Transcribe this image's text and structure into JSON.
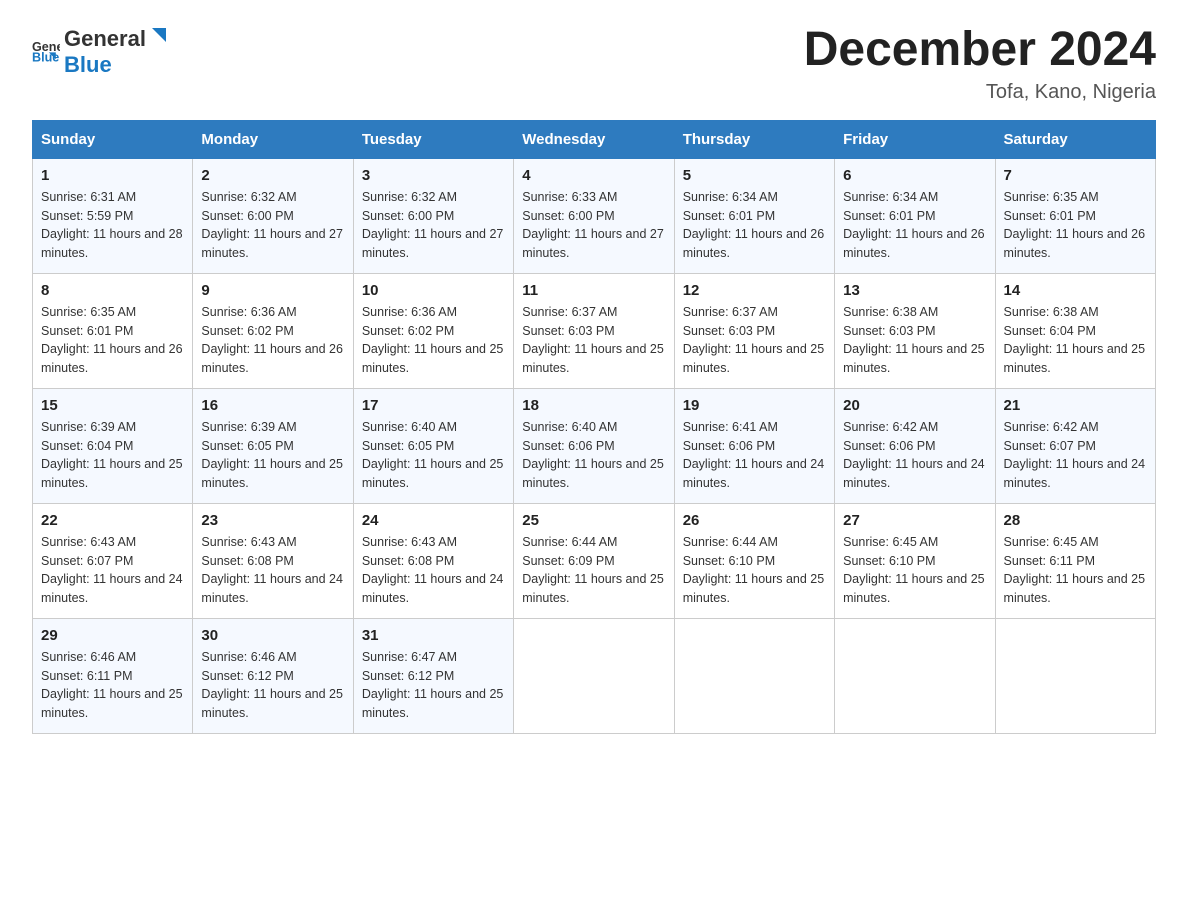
{
  "header": {
    "logo_general": "General",
    "logo_blue": "Blue",
    "title": "December 2024",
    "location": "Tofa, Kano, Nigeria"
  },
  "days_of_week": [
    "Sunday",
    "Monday",
    "Tuesday",
    "Wednesday",
    "Thursday",
    "Friday",
    "Saturday"
  ],
  "weeks": [
    [
      {
        "day": "1",
        "sunrise": "6:31 AM",
        "sunset": "5:59 PM",
        "daylight": "11 hours and 28 minutes."
      },
      {
        "day": "2",
        "sunrise": "6:32 AM",
        "sunset": "6:00 PM",
        "daylight": "11 hours and 27 minutes."
      },
      {
        "day": "3",
        "sunrise": "6:32 AM",
        "sunset": "6:00 PM",
        "daylight": "11 hours and 27 minutes."
      },
      {
        "day": "4",
        "sunrise": "6:33 AM",
        "sunset": "6:00 PM",
        "daylight": "11 hours and 27 minutes."
      },
      {
        "day": "5",
        "sunrise": "6:34 AM",
        "sunset": "6:01 PM",
        "daylight": "11 hours and 26 minutes."
      },
      {
        "day": "6",
        "sunrise": "6:34 AM",
        "sunset": "6:01 PM",
        "daylight": "11 hours and 26 minutes."
      },
      {
        "day": "7",
        "sunrise": "6:35 AM",
        "sunset": "6:01 PM",
        "daylight": "11 hours and 26 minutes."
      }
    ],
    [
      {
        "day": "8",
        "sunrise": "6:35 AM",
        "sunset": "6:01 PM",
        "daylight": "11 hours and 26 minutes."
      },
      {
        "day": "9",
        "sunrise": "6:36 AM",
        "sunset": "6:02 PM",
        "daylight": "11 hours and 26 minutes."
      },
      {
        "day": "10",
        "sunrise": "6:36 AM",
        "sunset": "6:02 PM",
        "daylight": "11 hours and 25 minutes."
      },
      {
        "day": "11",
        "sunrise": "6:37 AM",
        "sunset": "6:03 PM",
        "daylight": "11 hours and 25 minutes."
      },
      {
        "day": "12",
        "sunrise": "6:37 AM",
        "sunset": "6:03 PM",
        "daylight": "11 hours and 25 minutes."
      },
      {
        "day": "13",
        "sunrise": "6:38 AM",
        "sunset": "6:03 PM",
        "daylight": "11 hours and 25 minutes."
      },
      {
        "day": "14",
        "sunrise": "6:38 AM",
        "sunset": "6:04 PM",
        "daylight": "11 hours and 25 minutes."
      }
    ],
    [
      {
        "day": "15",
        "sunrise": "6:39 AM",
        "sunset": "6:04 PM",
        "daylight": "11 hours and 25 minutes."
      },
      {
        "day": "16",
        "sunrise": "6:39 AM",
        "sunset": "6:05 PM",
        "daylight": "11 hours and 25 minutes."
      },
      {
        "day": "17",
        "sunrise": "6:40 AM",
        "sunset": "6:05 PM",
        "daylight": "11 hours and 25 minutes."
      },
      {
        "day": "18",
        "sunrise": "6:40 AM",
        "sunset": "6:06 PM",
        "daylight": "11 hours and 25 minutes."
      },
      {
        "day": "19",
        "sunrise": "6:41 AM",
        "sunset": "6:06 PM",
        "daylight": "11 hours and 24 minutes."
      },
      {
        "day": "20",
        "sunrise": "6:42 AM",
        "sunset": "6:06 PM",
        "daylight": "11 hours and 24 minutes."
      },
      {
        "day": "21",
        "sunrise": "6:42 AM",
        "sunset": "6:07 PM",
        "daylight": "11 hours and 24 minutes."
      }
    ],
    [
      {
        "day": "22",
        "sunrise": "6:43 AM",
        "sunset": "6:07 PM",
        "daylight": "11 hours and 24 minutes."
      },
      {
        "day": "23",
        "sunrise": "6:43 AM",
        "sunset": "6:08 PM",
        "daylight": "11 hours and 24 minutes."
      },
      {
        "day": "24",
        "sunrise": "6:43 AM",
        "sunset": "6:08 PM",
        "daylight": "11 hours and 24 minutes."
      },
      {
        "day": "25",
        "sunrise": "6:44 AM",
        "sunset": "6:09 PM",
        "daylight": "11 hours and 25 minutes."
      },
      {
        "day": "26",
        "sunrise": "6:44 AM",
        "sunset": "6:10 PM",
        "daylight": "11 hours and 25 minutes."
      },
      {
        "day": "27",
        "sunrise": "6:45 AM",
        "sunset": "6:10 PM",
        "daylight": "11 hours and 25 minutes."
      },
      {
        "day": "28",
        "sunrise": "6:45 AM",
        "sunset": "6:11 PM",
        "daylight": "11 hours and 25 minutes."
      }
    ],
    [
      {
        "day": "29",
        "sunrise": "6:46 AM",
        "sunset": "6:11 PM",
        "daylight": "11 hours and 25 minutes."
      },
      {
        "day": "30",
        "sunrise": "6:46 AM",
        "sunset": "6:12 PM",
        "daylight": "11 hours and 25 minutes."
      },
      {
        "day": "31",
        "sunrise": "6:47 AM",
        "sunset": "6:12 PM",
        "daylight": "11 hours and 25 minutes."
      },
      null,
      null,
      null,
      null
    ]
  ]
}
